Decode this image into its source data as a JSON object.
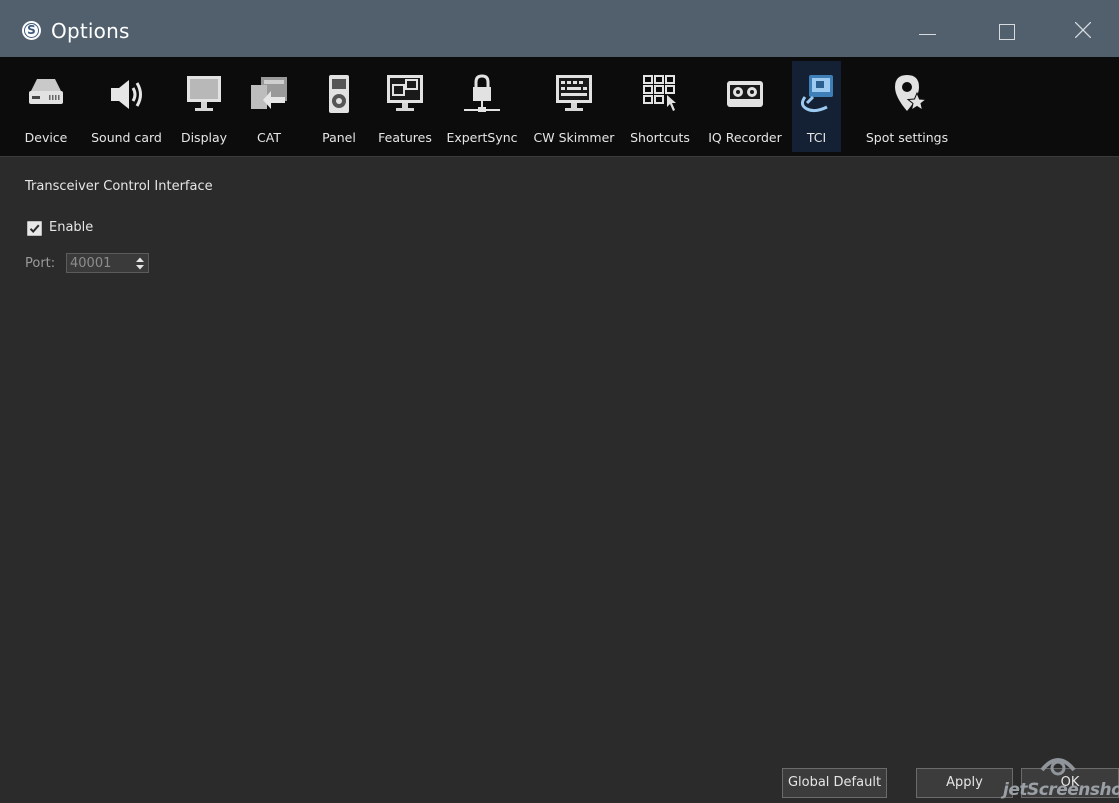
{
  "window": {
    "title": "Options",
    "controls": [
      "minimize",
      "maximize",
      "close"
    ]
  },
  "toolbar": {
    "items": [
      {
        "label": "Device",
        "icon": "device-icon"
      },
      {
        "label": "Sound card",
        "icon": "speaker-icon"
      },
      {
        "label": "Display",
        "icon": "monitor-icon"
      },
      {
        "label": "CAT",
        "icon": "cat-icon"
      },
      {
        "label": "Panel",
        "icon": "panel-icon"
      },
      {
        "label": "Features",
        "icon": "features-icon"
      },
      {
        "label": "ExpertSync",
        "icon": "lock-icon"
      },
      {
        "label": "CW Skimmer",
        "icon": "keyboard-monitor-icon"
      },
      {
        "label": "Shortcuts",
        "icon": "shortcuts-icon"
      },
      {
        "label": "IQ Recorder",
        "icon": "tape-recorder-icon"
      },
      {
        "label": "TCI",
        "icon": "tci-icon",
        "active": true
      },
      {
        "label": "Spot settings",
        "icon": "spot-star-icon"
      }
    ]
  },
  "tci": {
    "heading": "Transceiver Control Interface",
    "enable_label": "Enable",
    "enable_checked": true,
    "port_label": "Port:",
    "port_value": "40001"
  },
  "buttons": {
    "global_default": "Global Default",
    "apply": "Apply",
    "ok": "OK"
  },
  "watermark": "jetScreenshot",
  "colors": {
    "titlebar": "#52606e",
    "toolbar": "#0c0c0c",
    "content": "#2b2b2b",
    "active_tab": "#142033"
  }
}
